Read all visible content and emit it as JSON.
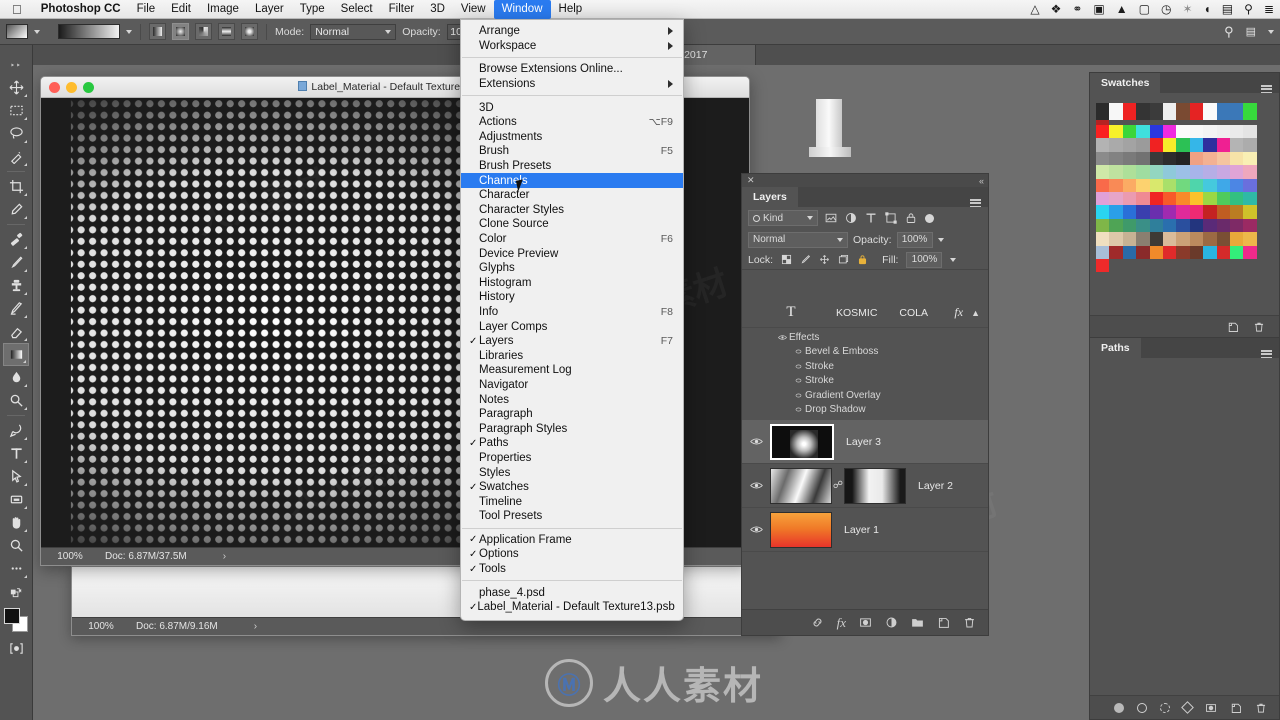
{
  "macmenu": {
    "apple_icon": "apple-icon",
    "app_name": "Photoshop CC",
    "items": [
      "File",
      "Edit",
      "Image",
      "Layer",
      "Type",
      "Select",
      "Filter",
      "3D",
      "View",
      "Window",
      "Help"
    ],
    "active_item": "Window",
    "status_icons": [
      "drive-icon",
      "dropbox-icon",
      "creative-cloud-icon",
      "screencast-icon",
      "home-icon",
      "airplay-icon",
      "clock-icon",
      "bluetooth-icon",
      "wifi-icon",
      "battery-icon",
      "search-icon",
      "control-center-icon"
    ]
  },
  "options_bar": {
    "gradient_preset_label": "gradient-preset-swatch",
    "gradient_strip_label": "gradient-editor-strip",
    "gradient_types": [
      "linear-gradient-icon",
      "radial-gradient-icon",
      "angle-gradient-icon",
      "reflected-gradient-icon",
      "diamond-gradient-icon"
    ],
    "selected_gradient_type_index": 1,
    "mode_label": "Mode:",
    "mode_value": "Normal",
    "opacity_label": "Opacity:",
    "opacity_value": "100%"
  },
  "doc_tab": {
    "partial_title": "2017"
  },
  "tools": {
    "items": [
      {
        "name": "move-tool"
      },
      {
        "name": "rectangular-marquee-tool"
      },
      {
        "name": "lasso-tool"
      },
      {
        "name": "quick-selection-tool"
      },
      {
        "name": "crop-tool"
      },
      {
        "name": "eyedropper-tool"
      },
      {
        "name": "healing-brush-tool"
      },
      {
        "name": "brush-tool"
      },
      {
        "name": "clone-stamp-tool"
      },
      {
        "name": "history-brush-tool"
      },
      {
        "name": "eraser-tool"
      },
      {
        "name": "gradient-tool"
      },
      {
        "name": "blur-tool"
      },
      {
        "name": "dodge-tool"
      },
      {
        "name": "pen-tool"
      },
      {
        "name": "type-tool"
      },
      {
        "name": "path-selection-tool"
      },
      {
        "name": "rectangle-tool"
      },
      {
        "name": "hand-tool"
      },
      {
        "name": "zoom-tool"
      },
      {
        "name": "edit-toolbar-tool"
      }
    ],
    "selected_tool": "gradient-tool",
    "foreground_color": "#111111",
    "background_color": "#ffffff"
  },
  "document": {
    "title": "Label_Material - Default Texture13.psb",
    "status_zoom": "100%",
    "status_doc": "Doc: 6.87M/37.5M",
    "status_arrow": "›"
  },
  "document2": {
    "status_zoom": "100%",
    "status_doc": "Doc: 6.87M/9.16M",
    "status_arrow": "›"
  },
  "window_menu": {
    "groups": [
      [
        {
          "label": "Arrange",
          "submenu": true,
          "checked": false,
          "shortcut": ""
        },
        {
          "label": "Workspace",
          "submenu": true,
          "checked": false,
          "shortcut": ""
        }
      ],
      [
        {
          "label": "Browse Extensions Online...",
          "submenu": false,
          "checked": false,
          "shortcut": ""
        },
        {
          "label": "Extensions",
          "submenu": true,
          "checked": false,
          "shortcut": ""
        }
      ],
      [
        {
          "label": "3D",
          "submenu": false,
          "checked": false,
          "shortcut": ""
        },
        {
          "label": "Actions",
          "submenu": false,
          "checked": false,
          "shortcut": "⌥F9"
        },
        {
          "label": "Adjustments",
          "submenu": false,
          "checked": false,
          "shortcut": ""
        },
        {
          "label": "Brush",
          "submenu": false,
          "checked": false,
          "shortcut": "F5"
        },
        {
          "label": "Brush Presets",
          "submenu": false,
          "checked": false,
          "shortcut": ""
        },
        {
          "label": "Channels",
          "submenu": false,
          "checked": false,
          "shortcut": "",
          "highlighted": true
        },
        {
          "label": "Character",
          "submenu": false,
          "checked": false,
          "shortcut": ""
        },
        {
          "label": "Character Styles",
          "submenu": false,
          "checked": false,
          "shortcut": ""
        },
        {
          "label": "Clone Source",
          "submenu": false,
          "checked": false,
          "shortcut": ""
        },
        {
          "label": "Color",
          "submenu": false,
          "checked": false,
          "shortcut": "F6"
        },
        {
          "label": "Device Preview",
          "submenu": false,
          "checked": false,
          "shortcut": ""
        },
        {
          "label": "Glyphs",
          "submenu": false,
          "checked": false,
          "shortcut": ""
        },
        {
          "label": "Histogram",
          "submenu": false,
          "checked": false,
          "shortcut": ""
        },
        {
          "label": "History",
          "submenu": false,
          "checked": false,
          "shortcut": ""
        },
        {
          "label": "Info",
          "submenu": false,
          "checked": false,
          "shortcut": "F8"
        },
        {
          "label": "Layer Comps",
          "submenu": false,
          "checked": false,
          "shortcut": ""
        },
        {
          "label": "Layers",
          "submenu": false,
          "checked": true,
          "shortcut": "F7"
        },
        {
          "label": "Libraries",
          "submenu": false,
          "checked": false,
          "shortcut": ""
        },
        {
          "label": "Measurement Log",
          "submenu": false,
          "checked": false,
          "shortcut": ""
        },
        {
          "label": "Navigator",
          "submenu": false,
          "checked": false,
          "shortcut": ""
        },
        {
          "label": "Notes",
          "submenu": false,
          "checked": false,
          "shortcut": ""
        },
        {
          "label": "Paragraph",
          "submenu": false,
          "checked": false,
          "shortcut": ""
        },
        {
          "label": "Paragraph Styles",
          "submenu": false,
          "checked": false,
          "shortcut": ""
        },
        {
          "label": "Paths",
          "submenu": false,
          "checked": true,
          "shortcut": ""
        },
        {
          "label": "Properties",
          "submenu": false,
          "checked": false,
          "shortcut": ""
        },
        {
          "label": "Styles",
          "submenu": false,
          "checked": false,
          "shortcut": ""
        },
        {
          "label": "Swatches",
          "submenu": false,
          "checked": true,
          "shortcut": ""
        },
        {
          "label": "Timeline",
          "submenu": false,
          "checked": false,
          "shortcut": ""
        },
        {
          "label": "Tool Presets",
          "submenu": false,
          "checked": false,
          "shortcut": ""
        }
      ],
      [
        {
          "label": "Application Frame",
          "submenu": false,
          "checked": true,
          "shortcut": ""
        },
        {
          "label": "Options",
          "submenu": false,
          "checked": true,
          "shortcut": ""
        },
        {
          "label": "Tools",
          "submenu": false,
          "checked": true,
          "shortcut": ""
        }
      ],
      [
        {
          "label": "phase_4.psd",
          "submenu": false,
          "checked": false,
          "shortcut": ""
        },
        {
          "label": "Label_Material - Default Texture13.psb",
          "submenu": false,
          "checked": true,
          "shortcut": ""
        }
      ]
    ]
  },
  "layers_panel": {
    "tab_label": "Layers",
    "filter_kind_label": "Kind",
    "filter_icons": [
      "pixel-filter-icon",
      "adjustment-filter-icon",
      "type-filter-icon",
      "shape-filter-icon",
      "smart-object-filter-icon"
    ],
    "blend_mode": "Normal",
    "opacity_label": "Opacity:",
    "opacity_value": "100%",
    "lock_label": "Lock:",
    "lock_icons": [
      "lock-transparent-pixels-icon",
      "lock-image-pixels-icon",
      "lock-position-icon",
      "lock-artboard-nesting-icon",
      "lock-all-icon"
    ],
    "fill_label": "Fill:",
    "fill_value": "100%",
    "text_layer": {
      "name_left": "KOSMIC",
      "name_right": "COLA",
      "fx_label": "fx",
      "type_icon": "type-layer-icon"
    },
    "effects": {
      "group_label": "Effects",
      "items": [
        "Bevel & Emboss",
        "Stroke",
        "Stroke",
        "Gradient Overlay",
        "Drop Shadow"
      ]
    },
    "layers": [
      {
        "name": "Layer 3",
        "visible": true,
        "selected": true,
        "has_mask": false
      },
      {
        "name": "Layer 2",
        "visible": true,
        "selected": false,
        "has_mask": true
      },
      {
        "name": "Layer 1",
        "visible": true,
        "selected": false,
        "has_mask": false
      }
    ],
    "footer_icons": [
      "link-layers-icon",
      "add-layer-style-icon",
      "add-layer-mask-icon",
      "new-fill-adjustment-layer-icon",
      "new-group-icon",
      "new-layer-icon",
      "delete-layer-icon"
    ]
  },
  "swatches_panel": {
    "tab_label": "Swatches",
    "footer_icons": [
      "new-swatch-icon",
      "delete-swatch-icon"
    ],
    "row1": [
      "#2b2b2b",
      "#f7f7f7",
      "#ee2222",
      "#343434",
      "#3b3b3b",
      "#efefef",
      "#7a4a32",
      "#e52323",
      "#fafafa",
      "#3b78b8",
      "#3b78b8",
      "#37d93c",
      "#b52222"
    ],
    "colors": [
      "#fa2020",
      "#f7f12a",
      "#3cd63a",
      "#3fe0dd",
      "#2a37e0",
      "#f02be0",
      "#fbfbfb",
      "#f7f7f7",
      "#f3f3f3",
      "#efefef",
      "#eaeaea",
      "#e4e4e4",
      "#b3b3b3",
      "#aaaaaa",
      "#a3a3a3",
      "#9b9b9b",
      "#f02222",
      "#f6ec2a",
      "#2cc155",
      "#35b6e8",
      "#2f2f9e",
      "#ef2092",
      "#b4b4b4",
      "#acacac",
      "#8b8b8b",
      "#828282",
      "#7a7a7a",
      "#727272",
      "#3a3a3a",
      "#2d2d2d",
      "#242424",
      "#f0a184",
      "#f3b193",
      "#f5c4a0",
      "#f7e3a8",
      "#f9efb4",
      "#cfe8a8",
      "#bfe29f",
      "#aee099",
      "#9fdda0",
      "#93d6c0",
      "#8fc9da",
      "#9cc0e6",
      "#a7b4ea",
      "#b6aee6",
      "#c9a8e2",
      "#e0a4d6",
      "#efa7bd",
      "#f96a4a",
      "#f98a56",
      "#fbab64",
      "#fcd26f",
      "#d9e86d",
      "#a9e06a",
      "#71d97f",
      "#4fd5ab",
      "#45c9dd",
      "#3fa8e8",
      "#4c86e4",
      "#6a6fdd",
      "#e0a0d8",
      "#e6a5c8",
      "#eb9bb0",
      "#ef8a93",
      "#f02424",
      "#f75a2a",
      "#f98a2a",
      "#fbc22a",
      "#9bd844",
      "#4fcb5c",
      "#33c081",
      "#2fb9a6",
      "#2ad4f0",
      "#2a9fe8",
      "#2a6fd8",
      "#3a3fae",
      "#6a2fae",
      "#a02ab0",
      "#e02a9a",
      "#ee2a73",
      "#c42222",
      "#c05d22",
      "#bb7d22",
      "#cfc22a",
      "#7fb648",
      "#4fa455",
      "#3f9a6a",
      "#3a8f87",
      "#2f7f9b",
      "#2a6fae",
      "#2a4f9e",
      "#23357e",
      "#5a2a78",
      "#6a2a6a",
      "#7e2a66",
      "#9b2a63",
      "#f0dfc0",
      "#ddc8a9",
      "#c7b294",
      "#8a7f70",
      "#3e3a35",
      "#d9bb9a",
      "#cba177",
      "#bb8a5e",
      "#9c6a44",
      "#7a4f34",
      "#e8a93a",
      "#edb74a",
      "#a8bed8",
      "#a02a2a",
      "#2a6aa8",
      "#8a2a2a",
      "#f08a2a",
      "#e02a2a",
      "#8a3a2a",
      "#6a3a2a",
      "#2ab4e0",
      "#d42a2a",
      "#33ee7a",
      "#ee2a8a",
      "#ee2a2a"
    ]
  },
  "paths_panel": {
    "tab_label": "Paths",
    "footer_icons": [
      "fill-path-icon",
      "stroke-path-icon",
      "load-path-as-selection-icon",
      "make-work-path-icon",
      "add-mask-icon",
      "new-path-icon",
      "delete-path-icon"
    ]
  },
  "watermark": {
    "text": "人人素材",
    "logo_glyph": "Ⓜ"
  },
  "play_overlay": {
    "icon": "play-icon"
  }
}
